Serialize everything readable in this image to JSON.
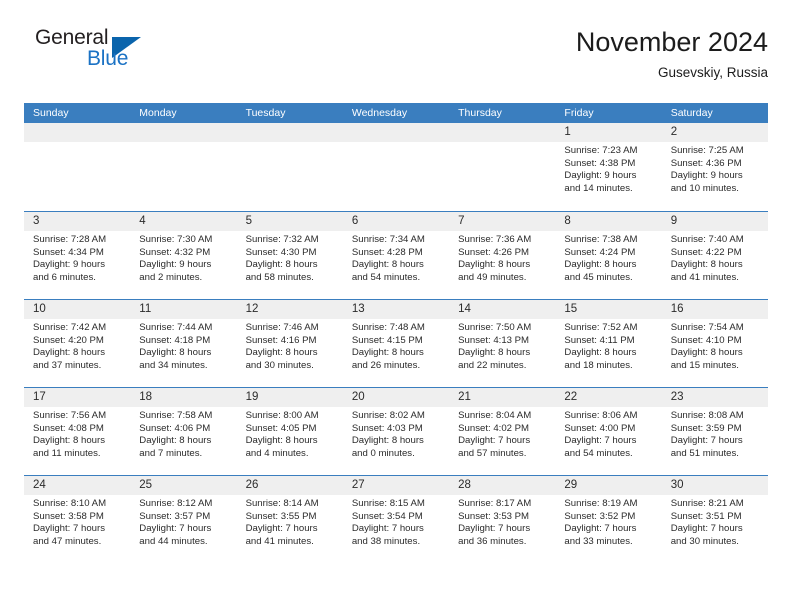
{
  "brand": {
    "name_part1": "General",
    "name_part2": "Blue",
    "flag_color": "#0a64ac",
    "text_color": "#231f20",
    "blue_text_color": "#1b72c4"
  },
  "header": {
    "title": "November 2024",
    "subtitle": "Gusevskiy, Russia"
  },
  "theme": {
    "header_bar": "#3a7ebf",
    "day_band": "#efefef",
    "row_border": "#3a7ebf",
    "text": "#2b2b2b"
  },
  "weekdays": [
    "Sunday",
    "Monday",
    "Tuesday",
    "Wednesday",
    "Thursday",
    "Friday",
    "Saturday"
  ],
  "weeks": [
    [
      {
        "day": "",
        "empty": true
      },
      {
        "day": "",
        "empty": true
      },
      {
        "day": "",
        "empty": true
      },
      {
        "day": "",
        "empty": true
      },
      {
        "day": "",
        "empty": true
      },
      {
        "day": "1",
        "sunrise": "Sunrise: 7:23 AM",
        "sunset": "Sunset: 4:38 PM",
        "daylight_line1": "Daylight: 9 hours",
        "daylight_line2": "and 14 minutes."
      },
      {
        "day": "2",
        "sunrise": "Sunrise: 7:25 AM",
        "sunset": "Sunset: 4:36 PM",
        "daylight_line1": "Daylight: 9 hours",
        "daylight_line2": "and 10 minutes."
      }
    ],
    [
      {
        "day": "3",
        "sunrise": "Sunrise: 7:28 AM",
        "sunset": "Sunset: 4:34 PM",
        "daylight_line1": "Daylight: 9 hours",
        "daylight_line2": "and 6 minutes."
      },
      {
        "day": "4",
        "sunrise": "Sunrise: 7:30 AM",
        "sunset": "Sunset: 4:32 PM",
        "daylight_line1": "Daylight: 9 hours",
        "daylight_line2": "and 2 minutes."
      },
      {
        "day": "5",
        "sunrise": "Sunrise: 7:32 AM",
        "sunset": "Sunset: 4:30 PM",
        "daylight_line1": "Daylight: 8 hours",
        "daylight_line2": "and 58 minutes."
      },
      {
        "day": "6",
        "sunrise": "Sunrise: 7:34 AM",
        "sunset": "Sunset: 4:28 PM",
        "daylight_line1": "Daylight: 8 hours",
        "daylight_line2": "and 54 minutes."
      },
      {
        "day": "7",
        "sunrise": "Sunrise: 7:36 AM",
        "sunset": "Sunset: 4:26 PM",
        "daylight_line1": "Daylight: 8 hours",
        "daylight_line2": "and 49 minutes."
      },
      {
        "day": "8",
        "sunrise": "Sunrise: 7:38 AM",
        "sunset": "Sunset: 4:24 PM",
        "daylight_line1": "Daylight: 8 hours",
        "daylight_line2": "and 45 minutes."
      },
      {
        "day": "9",
        "sunrise": "Sunrise: 7:40 AM",
        "sunset": "Sunset: 4:22 PM",
        "daylight_line1": "Daylight: 8 hours",
        "daylight_line2": "and 41 minutes."
      }
    ],
    [
      {
        "day": "10",
        "sunrise": "Sunrise: 7:42 AM",
        "sunset": "Sunset: 4:20 PM",
        "daylight_line1": "Daylight: 8 hours",
        "daylight_line2": "and 37 minutes."
      },
      {
        "day": "11",
        "sunrise": "Sunrise: 7:44 AM",
        "sunset": "Sunset: 4:18 PM",
        "daylight_line1": "Daylight: 8 hours",
        "daylight_line2": "and 34 minutes."
      },
      {
        "day": "12",
        "sunrise": "Sunrise: 7:46 AM",
        "sunset": "Sunset: 4:16 PM",
        "daylight_line1": "Daylight: 8 hours",
        "daylight_line2": "and 30 minutes."
      },
      {
        "day": "13",
        "sunrise": "Sunrise: 7:48 AM",
        "sunset": "Sunset: 4:15 PM",
        "daylight_line1": "Daylight: 8 hours",
        "daylight_line2": "and 26 minutes."
      },
      {
        "day": "14",
        "sunrise": "Sunrise: 7:50 AM",
        "sunset": "Sunset: 4:13 PM",
        "daylight_line1": "Daylight: 8 hours",
        "daylight_line2": "and 22 minutes."
      },
      {
        "day": "15",
        "sunrise": "Sunrise: 7:52 AM",
        "sunset": "Sunset: 4:11 PM",
        "daylight_line1": "Daylight: 8 hours",
        "daylight_line2": "and 18 minutes."
      },
      {
        "day": "16",
        "sunrise": "Sunrise: 7:54 AM",
        "sunset": "Sunset: 4:10 PM",
        "daylight_line1": "Daylight: 8 hours",
        "daylight_line2": "and 15 minutes."
      }
    ],
    [
      {
        "day": "17",
        "sunrise": "Sunrise: 7:56 AM",
        "sunset": "Sunset: 4:08 PM",
        "daylight_line1": "Daylight: 8 hours",
        "daylight_line2": "and 11 minutes."
      },
      {
        "day": "18",
        "sunrise": "Sunrise: 7:58 AM",
        "sunset": "Sunset: 4:06 PM",
        "daylight_line1": "Daylight: 8 hours",
        "daylight_line2": "and 7 minutes."
      },
      {
        "day": "19",
        "sunrise": "Sunrise: 8:00 AM",
        "sunset": "Sunset: 4:05 PM",
        "daylight_line1": "Daylight: 8 hours",
        "daylight_line2": "and 4 minutes."
      },
      {
        "day": "20",
        "sunrise": "Sunrise: 8:02 AM",
        "sunset": "Sunset: 4:03 PM",
        "daylight_line1": "Daylight: 8 hours",
        "daylight_line2": "and 0 minutes."
      },
      {
        "day": "21",
        "sunrise": "Sunrise: 8:04 AM",
        "sunset": "Sunset: 4:02 PM",
        "daylight_line1": "Daylight: 7 hours",
        "daylight_line2": "and 57 minutes."
      },
      {
        "day": "22",
        "sunrise": "Sunrise: 8:06 AM",
        "sunset": "Sunset: 4:00 PM",
        "daylight_line1": "Daylight: 7 hours",
        "daylight_line2": "and 54 minutes."
      },
      {
        "day": "23",
        "sunrise": "Sunrise: 8:08 AM",
        "sunset": "Sunset: 3:59 PM",
        "daylight_line1": "Daylight: 7 hours",
        "daylight_line2": "and 51 minutes."
      }
    ],
    [
      {
        "day": "24",
        "sunrise": "Sunrise: 8:10 AM",
        "sunset": "Sunset: 3:58 PM",
        "daylight_line1": "Daylight: 7 hours",
        "daylight_line2": "and 47 minutes."
      },
      {
        "day": "25",
        "sunrise": "Sunrise: 8:12 AM",
        "sunset": "Sunset: 3:57 PM",
        "daylight_line1": "Daylight: 7 hours",
        "daylight_line2": "and 44 minutes."
      },
      {
        "day": "26",
        "sunrise": "Sunrise: 8:14 AM",
        "sunset": "Sunset: 3:55 PM",
        "daylight_line1": "Daylight: 7 hours",
        "daylight_line2": "and 41 minutes."
      },
      {
        "day": "27",
        "sunrise": "Sunrise: 8:15 AM",
        "sunset": "Sunset: 3:54 PM",
        "daylight_line1": "Daylight: 7 hours",
        "daylight_line2": "and 38 minutes."
      },
      {
        "day": "28",
        "sunrise": "Sunrise: 8:17 AM",
        "sunset": "Sunset: 3:53 PM",
        "daylight_line1": "Daylight: 7 hours",
        "daylight_line2": "and 36 minutes."
      },
      {
        "day": "29",
        "sunrise": "Sunrise: 8:19 AM",
        "sunset": "Sunset: 3:52 PM",
        "daylight_line1": "Daylight: 7 hours",
        "daylight_line2": "and 33 minutes."
      },
      {
        "day": "30",
        "sunrise": "Sunrise: 8:21 AM",
        "sunset": "Sunset: 3:51 PM",
        "daylight_line1": "Daylight: 7 hours",
        "daylight_line2": "and 30 minutes."
      }
    ]
  ]
}
